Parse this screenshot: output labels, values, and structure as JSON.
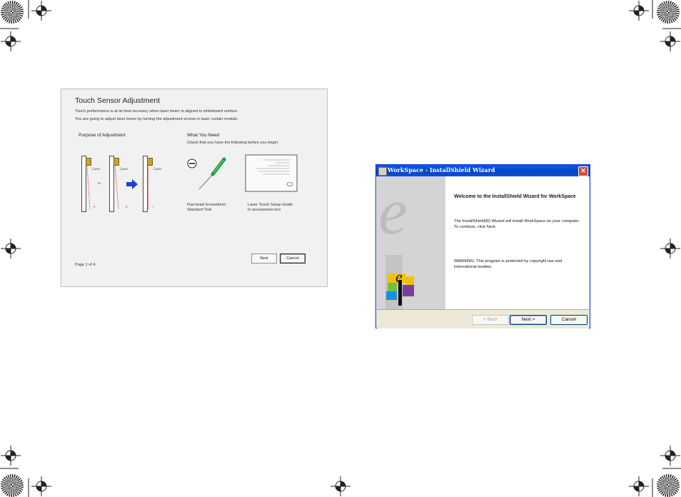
{
  "touch_sensor": {
    "title": "Touch Sensor Adjustment",
    "intro1": "Touch performance is at its best accuracy when laser beam is aligned to whiteboard surface.",
    "intro2": "You are going to adjust laser beam by turning the adjustment screws in laser curtain module.",
    "purpose_heading": "Purpose of Adjustment",
    "need_heading": "What You Need",
    "need_text": "Check that you have the following before you begin:",
    "laser_label": "Laser",
    "or_label": "or",
    "screwdriver_caption1": "Flat-head Screwdriver",
    "screwdriver_caption2": "Standard Tool",
    "guide_caption1": "Laser Touch Setup Guide",
    "guide_caption2": "In accessories box",
    "next_button": "Next",
    "cancel_button": "Cancel",
    "page_label": "Page 1 of 4",
    "colors": {
      "arrow": "#1f3fd8",
      "sensor": "#caa231",
      "beam": "#e33333",
      "check": "#2aa44a"
    }
  },
  "wizard": {
    "window_title": "WorkSpace - InstallShield Wizard",
    "close_glyph": "✕",
    "heading": "Welcome to the InstallShield Wizard for WorkSpace",
    "body_text": "The InstallShield(R) Wizard will install WorkSpace on your computer. To continue, click Next.",
    "warning_text": "WARNING: This program is protected by copyright law and international treaties.",
    "back_button": "< Back",
    "next_button": "Next >",
    "cancel_button": "Cancel",
    "logo_letter": "e",
    "colors": {
      "titlebar": "#0a52d6",
      "logo_yellow": "#f2c200",
      "logo_green": "#6cc04a",
      "logo_blue": "#1d8fd8",
      "logo_purple": "#7a3f9d"
    }
  }
}
